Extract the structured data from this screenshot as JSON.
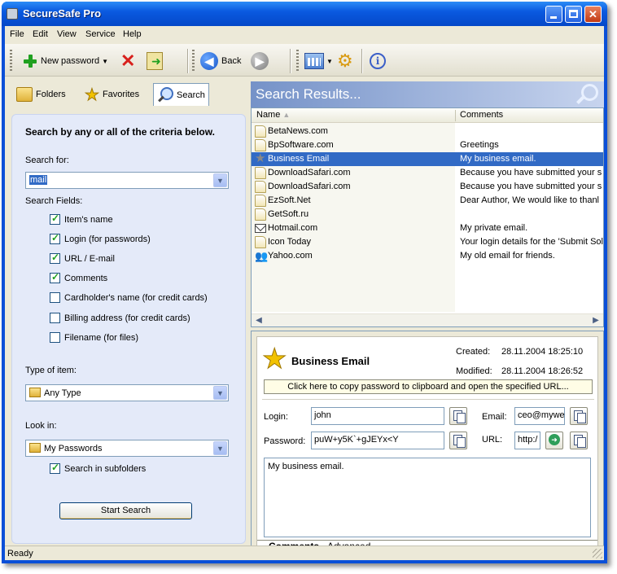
{
  "window": {
    "title": "SecureSafe Pro"
  },
  "menu": [
    "File",
    "Edit",
    "View",
    "Service",
    "Help"
  ],
  "toolbar": {
    "new_password": "New password",
    "back": "Back"
  },
  "left_tabs": {
    "folders": "Folders",
    "favorites": "Favorites",
    "search": "Search"
  },
  "search": {
    "heading": "Search by any or all of the criteria below.",
    "search_for_label": "Search for:",
    "search_for_value": "mail",
    "fields_label": "Search Fields:",
    "fields": [
      {
        "label": "Item's name",
        "checked": true
      },
      {
        "label": "Login (for passwords)",
        "checked": true
      },
      {
        "label": "URL / E-mail",
        "checked": true
      },
      {
        "label": "Comments",
        "checked": true
      },
      {
        "label": "Cardholder's name (for credit cards)",
        "checked": false
      },
      {
        "label": "Billing address (for credit cards)",
        "checked": false
      },
      {
        "label": "Filename (for files)",
        "checked": false
      }
    ],
    "type_label": "Type of item:",
    "type_value": "Any Type",
    "look_in_label": "Look in:",
    "look_in_value": "My Passwords",
    "subfolders_label": "Search in subfolders",
    "subfolders_checked": true,
    "start_button": "Start Search"
  },
  "results": {
    "title": "Search Results...",
    "columns": {
      "name": "Name",
      "comments": "Comments"
    },
    "rows": [
      {
        "name": "BetaNews.com",
        "comment": "",
        "icon": "doc-icon",
        "selected": false
      },
      {
        "name": "BpSoftware.com",
        "comment": "Greetings",
        "icon": "doc-icon",
        "selected": false
      },
      {
        "name": "Business Email",
        "comment": "My business email.",
        "icon": "star-icon",
        "selected": true
      },
      {
        "name": "DownloadSafari.com",
        "comment": " Because you have submitted your s",
        "icon": "doc-icon",
        "selected": false
      },
      {
        "name": "DownloadSafari.com",
        "comment": " Because you have submitted your s",
        "icon": "doc-icon",
        "selected": false
      },
      {
        "name": "EzSoft.Net",
        "comment": "Dear Author,  We would like to thanl",
        "icon": "doc-icon",
        "selected": false
      },
      {
        "name": "GetSoft.ru",
        "comment": "",
        "icon": "doc-icon",
        "selected": false
      },
      {
        "name": "Hotmail.com",
        "comment": "My private email.",
        "icon": "envelope-icon",
        "selected": false
      },
      {
        "name": "Icon Today",
        "comment": " Your login details for the 'Submit Sol",
        "icon": "doc-icon",
        "selected": false
      },
      {
        "name": "Yahoo.com",
        "comment": "My old email for friends.",
        "icon": "users-icon",
        "selected": false
      }
    ]
  },
  "detail": {
    "title": "Business Email",
    "created_label": "Created:",
    "created_value": "28.11.2004 18:25:10",
    "modified_label": "Modified:",
    "modified_value": "28.11.2004 18:26:52",
    "copy_bar": "Click here to copy password to clipboard and open the specified URL...",
    "login_label": "Login:",
    "login_value": "john",
    "password_label": "Password:",
    "password_value": "puW+y5K`+gJEYx<Y",
    "email_label": "Email:",
    "email_value": "ceo@mywe",
    "url_label": "URL:",
    "url_value": "http:/",
    "comment": "My business email.",
    "tabs": {
      "comments": "Comments",
      "advanced": "Advanced"
    }
  },
  "status": "Ready"
}
